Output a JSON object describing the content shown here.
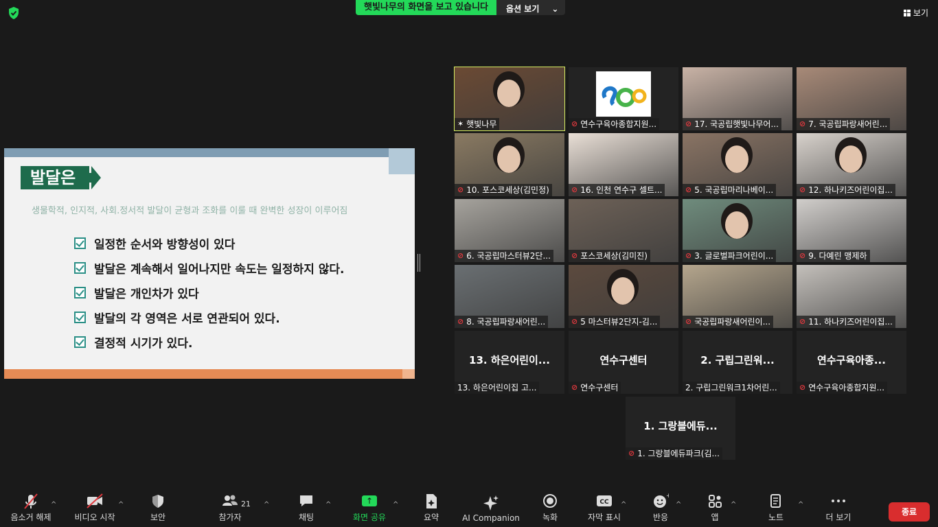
{
  "top": {
    "sharing_text": "햇빛나무의 화면을 보고 있습니다",
    "options_label": "옵션 보기",
    "view_label": "보기"
  },
  "slide": {
    "title": "발달은",
    "subtitle": "생물학적, 인지적, 사회.정서적 발달이 균형과 조화를 이룰 때 완벽한 성장이 이루어짐",
    "items": [
      "일정한 순서와 방향성이  있다",
      "발달은 계속해서 일어나지만 속도는 일정하지 않다.",
      "발달은 개인차가 있다",
      "발달의 각 영역은 서로 연관되어 있다.",
      "결정적 시기가 있다."
    ]
  },
  "participants": [
    {
      "name": "햇빛나무",
      "active": true,
      "video": "person",
      "color": "#6b4a34"
    },
    {
      "name": "연수구육아종합지원...",
      "video": "logo",
      "color": "#ffffff"
    },
    {
      "name": "17. 국공립햇빛나무어...",
      "video": "room",
      "color": "#c9b3a6"
    },
    {
      "name": "7. 국공립파랑새어린...",
      "video": "room",
      "color": "#a88a78"
    },
    {
      "name": "10. 포스코세상(김민정)",
      "video": "person",
      "color": "#8a7a62"
    },
    {
      "name": "16. 인천 연수구 셀트...",
      "video": "room",
      "color": "#e9dfd6"
    },
    {
      "name": "5. 국공립마리나베이...",
      "video": "person",
      "color": "#8a7464"
    },
    {
      "name": "12. 하나키즈어린이집...",
      "video": "person",
      "color": "#d8d2cc"
    },
    {
      "name": "6. 국공립마스터뷰2단...",
      "video": "room",
      "color": "#a6a39d"
    },
    {
      "name": "포스코세상(김미진)",
      "video": "room",
      "color": "#6d6157"
    },
    {
      "name": "3. 글로벌파크어린이...",
      "video": "person",
      "color": "#6f8c7d"
    },
    {
      "name": "9. 다예린 맹제하",
      "video": "room",
      "color": "#d1cecb"
    },
    {
      "name": "8. 국공립파랑새어린...",
      "video": "room",
      "color": "#6a6f72"
    },
    {
      "name": "5 마스터뷰2단지-김...",
      "video": "person",
      "color": "#5c4a3e"
    },
    {
      "name": "국공립파랑새어린이...",
      "video": "room",
      "color": "#b5a68d"
    },
    {
      "name": "11. 하나키즈어린이집...",
      "video": "room",
      "color": "#c4c0bb"
    },
    {
      "name": "13. 하은어린이집 고...",
      "video": "none",
      "big": "13. 하은어린이...",
      "muted": false
    },
    {
      "name": "연수구센터",
      "video": "none",
      "big": "연수구센터"
    },
    {
      "name": "2. 구립그린워크1차어린...",
      "video": "none",
      "big": "2. 구립그린워...",
      "muted": false
    },
    {
      "name": "연수구육아종합지원...",
      "video": "none",
      "big": "연수구육아종..."
    },
    {
      "name": "1. 그랑블에듀파크(김...",
      "video": "none",
      "big": "1. 그랑블에듀..."
    }
  ],
  "toolbar": {
    "unmute": "음소거 해제",
    "start_video": "비디오 시작",
    "security": "보안",
    "participants": "참가자",
    "participants_count": "21",
    "chat": "채팅",
    "share": "화면 공유",
    "summary": "요약",
    "ai": "AI Companion",
    "record": "녹화",
    "captions": "자막 표시",
    "reactions": "반응",
    "apps": "앱",
    "notes": "노트",
    "more": "더 보기",
    "end": "종료"
  },
  "colors": {
    "share_green": "#23d959",
    "end_red": "#d92d2e",
    "active_border": "#d7ef62",
    "slide_green": "#1e6b4c"
  }
}
